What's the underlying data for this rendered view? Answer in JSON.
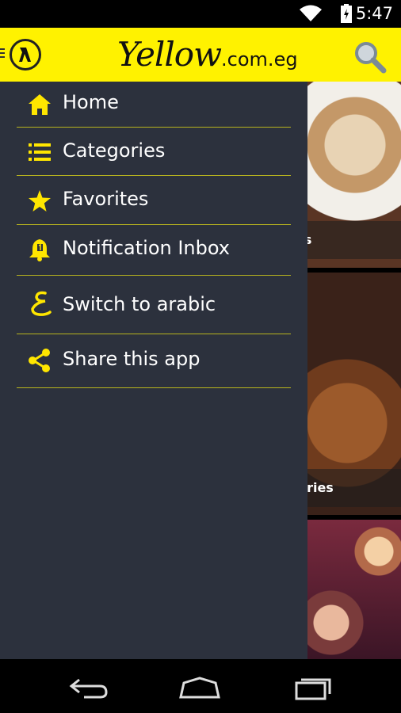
{
  "status_bar": {
    "time": "5:47",
    "wifi_icon": "wifi-icon",
    "battery_icon": "battery-charging-icon"
  },
  "header": {
    "logo_icon": "yellow-pages-walking-fingers-icon",
    "brand_script": "Yellow",
    "brand_domain": ".com.eg",
    "search_icon": "search-icon"
  },
  "drawer": {
    "items": [
      {
        "label": "Home",
        "icon": "home-icon"
      },
      {
        "label": "Categories",
        "icon": "list-icon"
      },
      {
        "label": "Favorites",
        "icon": "star-icon"
      },
      {
        "label": "Notification Inbox",
        "icon": "notification-bell-icon"
      },
      {
        "label": "Switch to arabic",
        "icon": "arabic-letter-icon"
      },
      {
        "label": "Share this app",
        "icon": "share-icon"
      }
    ]
  },
  "background_tiles": [
    {
      "label": "fes"
    },
    {
      "label": "keries"
    },
    {
      "label": ""
    }
  ],
  "nav_bar": {
    "back_icon": "back-icon",
    "home_icon": "home-nav-icon",
    "recent_icon": "recent-apps-icon"
  },
  "colors": {
    "accent": "#fff200",
    "drawer_bg": "#2c313d",
    "divider": "#b8b41e",
    "icon_yellow": "#ffe600"
  }
}
